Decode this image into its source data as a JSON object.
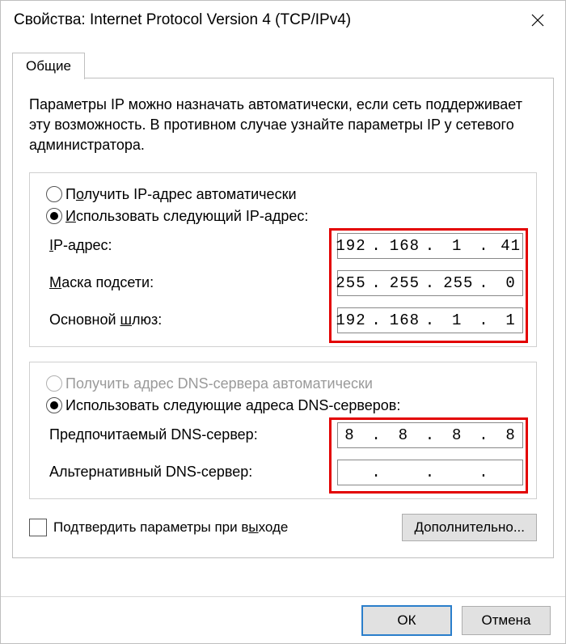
{
  "window": {
    "title": "Свойства: Internet Protocol Version 4 (TCP/IPv4)"
  },
  "tab": {
    "general": "Общие"
  },
  "description": "Параметры IP можно назначать автоматически, если сеть поддерживает эту возможность. В противном случае узнайте параметры IP у сетевого администратора.",
  "ip_group": {
    "auto_pre": "П",
    "auto_ul": "о",
    "auto_post": "лучить IP-адрес автоматически",
    "use_ul": "И",
    "use_post": "спользовать следующий IP-адрес:",
    "ip_label_ul": "I",
    "ip_label_post": "P-адрес:",
    "mask_ul": "М",
    "mask_post": "аска подсети:",
    "gw_pre": "Основной ",
    "gw_ul": "ш",
    "gw_post": "люз:",
    "ip_o1": "192",
    "ip_o2": "168",
    "ip_o3": "1",
    "ip_o4": "41",
    "mk_o1": "255",
    "mk_o2": "255",
    "mk_o3": "255",
    "mk_o4": "0",
    "gw_o1": "192",
    "gw_o2": "168",
    "gw_o3": "1",
    "gw_o4": "1"
  },
  "dns_group": {
    "auto_pre": "Получить адрес DNS-сервера автоматически",
    "use_pre": "Использовать следующие адреса DNS-серверов:",
    "pref_label": "Предпочитаемый DNS-сервер:",
    "alt_label": "Альтернативный DNS-сервер:",
    "p_o1": "8",
    "p_o2": "8",
    "p_o3": "8",
    "p_o4": "8",
    "a_o1": "",
    "a_o2": "",
    "a_o3": "",
    "a_o4": ""
  },
  "confirm": {
    "pre": "Подтвердить параметры при в",
    "ul": "ы",
    "post": "ходе"
  },
  "advanced": {
    "ul": "Д",
    "post": "ополнительно..."
  },
  "buttons": {
    "ok": "ОК",
    "cancel": "Отмена"
  }
}
